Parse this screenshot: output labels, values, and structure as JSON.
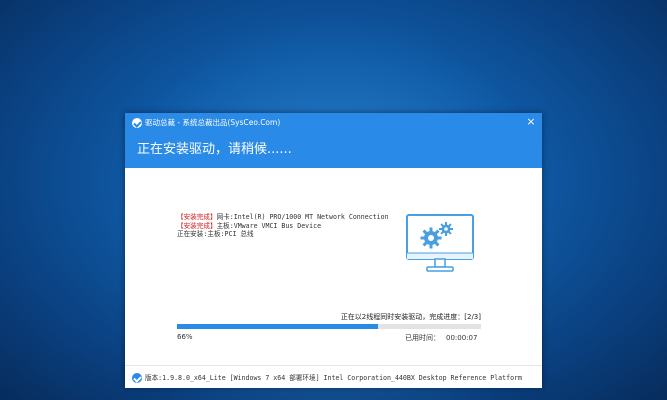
{
  "window": {
    "title": "驱动总裁 - 系统总裁出品(SysCeo.Com)",
    "close_glyph": "×",
    "header": "正在安装驱动，请稍候......"
  },
  "log": {
    "lines": [
      {
        "tag": "【安装完成】",
        "text": "网卡:Intel(R) PRO/1000 MT Network Connection"
      },
      {
        "tag": "【安装完成】",
        "text": "主板:VMware VMCI Bus Device"
      },
      {
        "tag": "正在安装:",
        "text": "主板:PCI 总线"
      }
    ]
  },
  "progress": {
    "caption": "正在以2线程同时安装驱动，完成进度：[2/3]",
    "percent_value": 0.66,
    "percent_text": "66%",
    "elapsed_label": "已用时间：",
    "elapsed_value": "00:00:07"
  },
  "footer": {
    "version_text": "版本:1.9.8.0_x64_Lite [Windows 7 x64 部署环境] Intel Corporation_440BX Desktop Reference Platform"
  },
  "colors": {
    "accent": "#2a8ae8",
    "installed_tag": "#d02020"
  },
  "icons": {
    "app": "syscao-logo-icon",
    "illustration": "monitor-gears-icon"
  }
}
